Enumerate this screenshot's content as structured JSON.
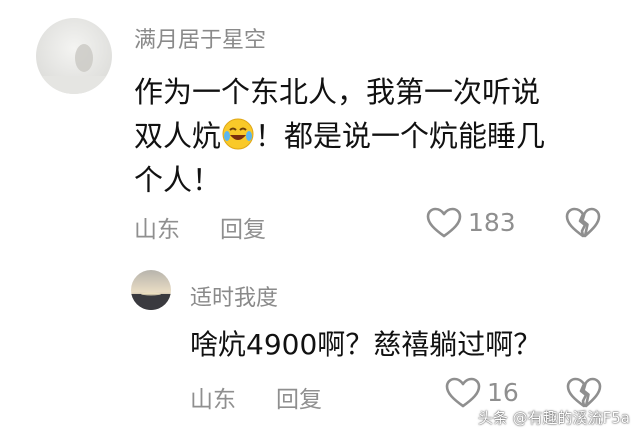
{
  "comment": {
    "username": "满月居于星空",
    "lines": [
      "作为一个东北人，我第一次听说",
      "双人炕",
      "！都是说一个炕能睡几",
      "个人！"
    ],
    "emoji": "laughing-crying-emoji",
    "location": "山东",
    "reply_label": "回复",
    "like_count": "183"
  },
  "reply": {
    "username": "适时我度",
    "text": "啥炕4900啊？慈禧躺过啊？",
    "location": "山东",
    "reply_label": "回复",
    "like_count": "16"
  },
  "watermark": "头条 @有趣的溪流F5a",
  "colors": {
    "text": "#111111",
    "muted": "#8f8f8f",
    "username": "#8a8a8a",
    "background": "#ffffff"
  }
}
